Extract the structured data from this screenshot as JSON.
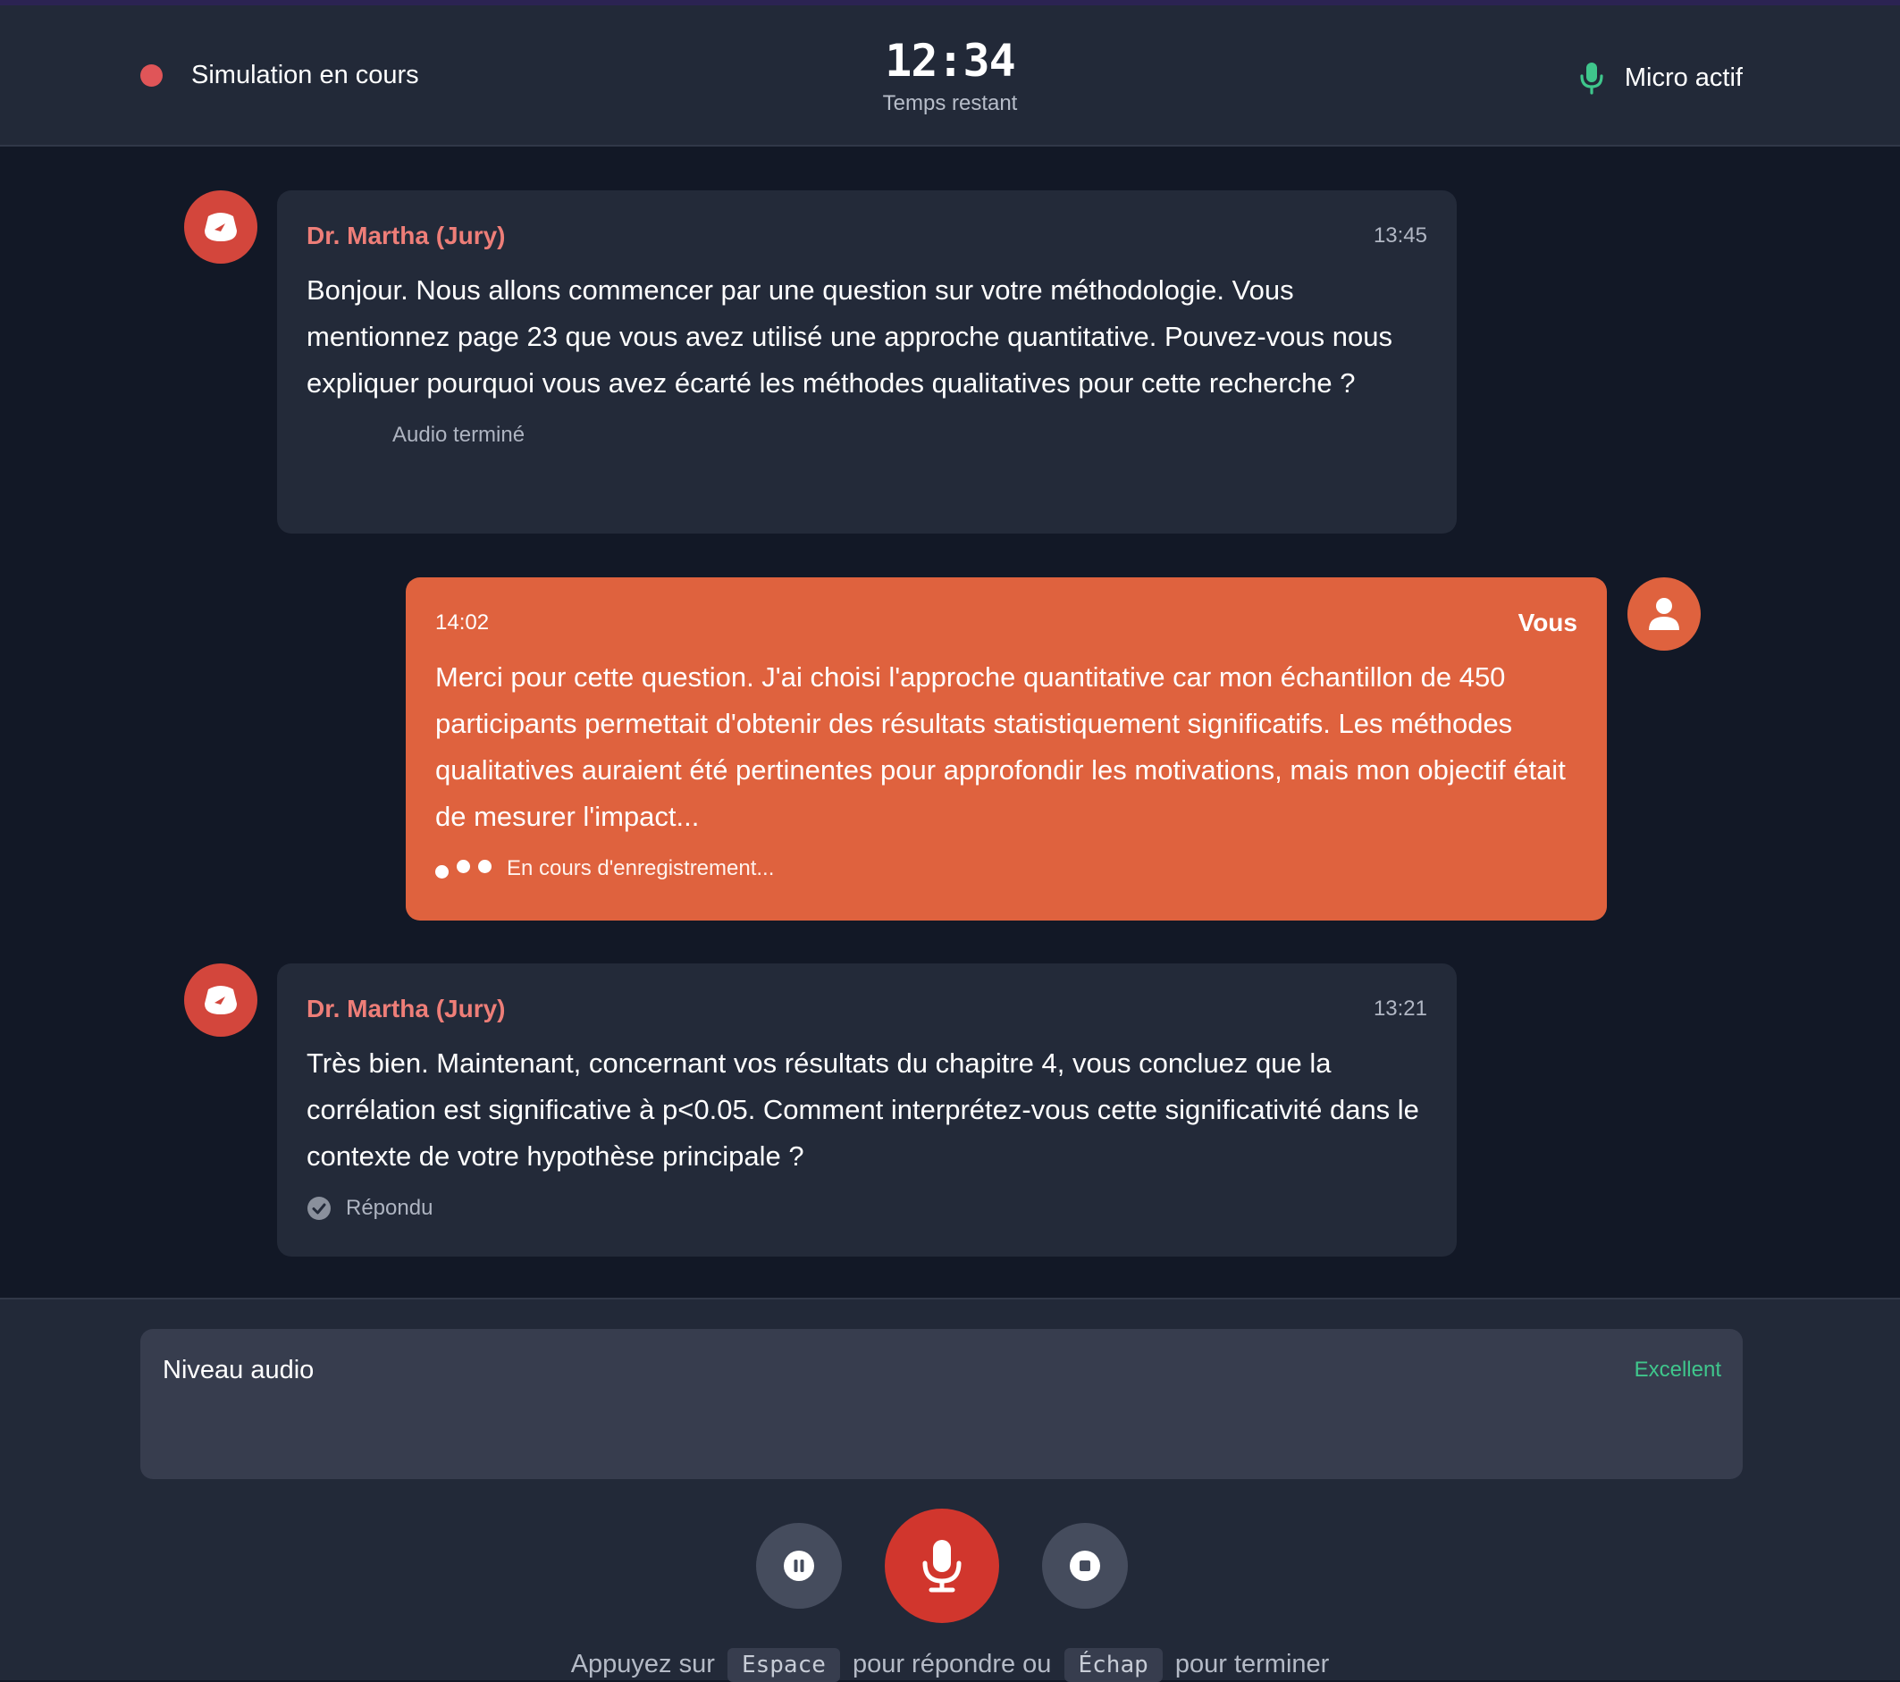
{
  "header": {
    "status_label": "Simulation en cours",
    "status_color": "#e05558",
    "timer_value": "12:34",
    "timer_label": "Temps restant",
    "mic_label": "Micro actif",
    "mic_icon": "microphone-icon",
    "mic_color": "#3fc68c"
  },
  "messages": [
    {
      "sender": "Dr. Martha (Jury)",
      "role": "jury",
      "time": "13:45",
      "text": "Bonjour. Nous allons commencer par une question sur votre méthodologie. Vous mentionnez page 23 que vous avez utilisé une approche quantitative. Pouvez-vous nous expliquer pourquoi vous avez écarté les méthodes qualitatives pour cette recherche ?",
      "status": "Audio terminé",
      "avatar_icon": "gauge-icon"
    },
    {
      "sender": "Vous",
      "role": "user",
      "time": "14:02",
      "text": "Merci pour cette question. J'ai choisi l'approche quantitative car mon échantillon de 450 participants permettait d'obtenir des résultats statistiquement significatifs. Les méthodes qualitatives auraient été pertinentes pour approfondir les motivations, mais mon objectif était de mesurer l'impact...",
      "status": "En cours d'enregistrement...",
      "avatar_icon": "user-icon"
    },
    {
      "sender": "Dr. Martha (Jury)",
      "role": "jury",
      "time": "13:21",
      "text": "Très bien. Maintenant, concernant vos résultats du chapitre 4, vous concluez que la corrélation est significative à p<0.05. Comment interprétez-vous cette significativité dans le contexte de votre hypothèse principale ?",
      "status": "Répondu",
      "avatar_icon": "gauge-icon",
      "status_icon": "check-circle-icon"
    }
  ],
  "audio": {
    "label": "Niveau audio",
    "quality": "Excellent",
    "quality_color": "#3fc68c"
  },
  "controls": {
    "pause_icon": "pause-icon",
    "mic_icon": "microphone-icon",
    "stop_icon": "stop-icon",
    "mic_color": "#d1362d"
  },
  "hint": {
    "part1": "Appuyez sur",
    "key1": "Espace",
    "part2": "pour répondre ou",
    "key2": "Échap",
    "part3": "pour terminer"
  }
}
